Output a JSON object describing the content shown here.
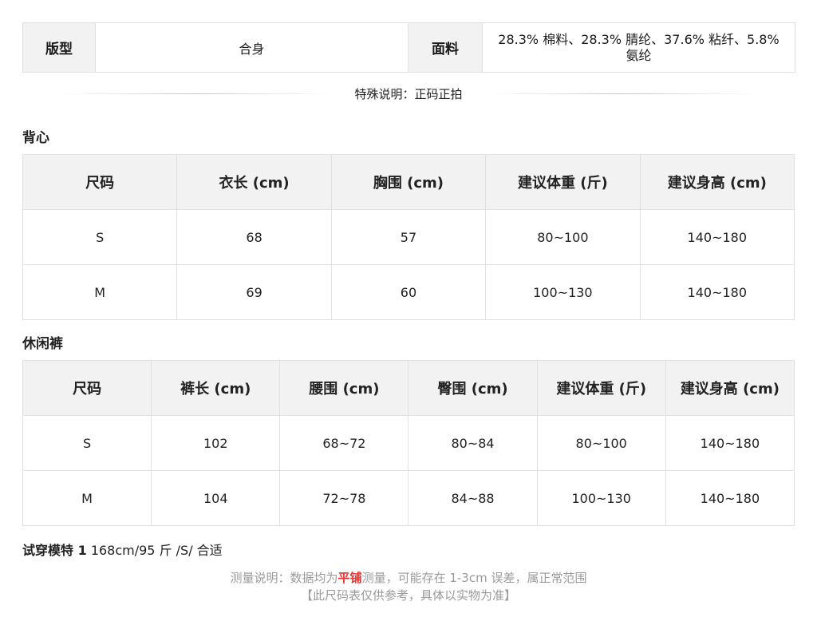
{
  "attributes": {
    "fit_label": "版型",
    "fit_value": "合身",
    "fabric_label": "面料",
    "fabric_value": "28.3% 棉料、28.3% 腈纶、37.6% 粘纤、5.8% 氨纶"
  },
  "special_note": "特殊说明：正码正拍",
  "vest": {
    "title": "背心",
    "headers": [
      "尺码",
      "衣长 (cm)",
      "胸围 (cm)",
      "建议体重 (斤)",
      "建议身高 (cm)"
    ],
    "rows": [
      [
        "S",
        "68",
        "57",
        "80~100",
        "140~180"
      ],
      [
        "M",
        "69",
        "60",
        "100~130",
        "140~180"
      ]
    ]
  },
  "pants": {
    "title": "休闲裤",
    "headers": [
      "尺码",
      "裤长 (cm)",
      "腰围 (cm)",
      "臀围 (cm)",
      "建议体重 (斤)",
      "建议身高 (cm)"
    ],
    "rows": [
      [
        "S",
        "102",
        "68~72",
        "80~84",
        "80~100",
        "140~180"
      ],
      [
        "M",
        "104",
        "72~78",
        "84~88",
        "100~130",
        "140~180"
      ]
    ]
  },
  "model": {
    "label": "试穿模特 1",
    "value": "168cm/95 斤 /S/ 合适"
  },
  "footer": {
    "line1_before": "测量说明：数据均为",
    "line1_highlight": "平铺",
    "line1_after": "测量，可能存在 1-3cm 误差，属正常范围",
    "line2": "【此尺码表仅供参考，具体以实物为准】",
    "highlight_color": "#e8312f"
  }
}
